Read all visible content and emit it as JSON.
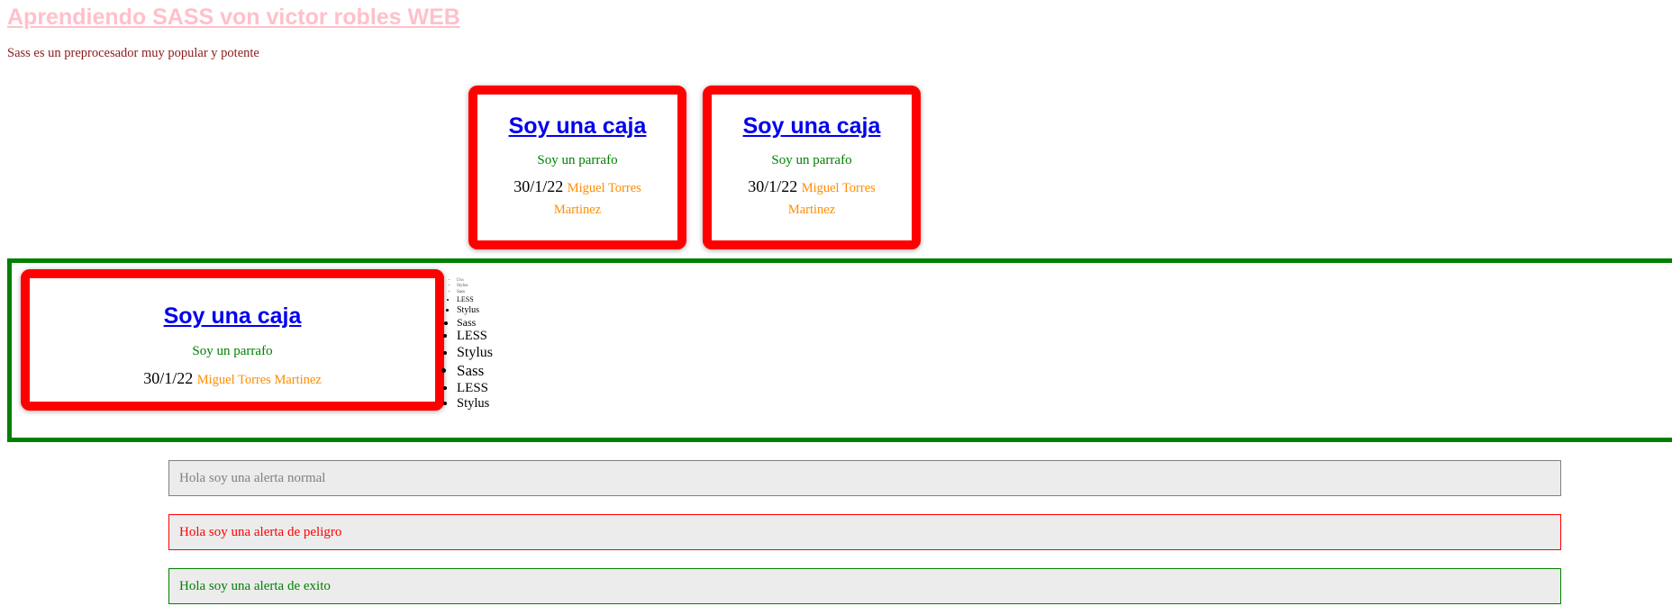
{
  "header": {
    "title": "Aprendiendo SASS von victor robles WEB",
    "intro": "Sass es un preprocesador muy popular y potente"
  },
  "cajas": [
    {
      "title": "Soy una caja",
      "text": "Soy un parrafo",
      "date": "30/1/22",
      "author": "Miguel Torres Martinez"
    },
    {
      "title": "Soy una caja",
      "text": "Soy un parrafo",
      "date": "30/1/22",
      "author": "Miguel Torres Martinez"
    },
    {
      "title": "Soy una caja",
      "text": "Soy un parrafo",
      "date": "30/1/22",
      "author": "Miguel Torres Martinez"
    }
  ],
  "lista": [
    "Dos",
    "Stylus",
    "Sass",
    "LESS",
    "Stylus",
    "Sass",
    "LESS",
    "Stylus",
    "Sass",
    "LESS",
    "Stylus"
  ],
  "alertas": {
    "normal": "Hola soy una alerta normal",
    "peligro": "Hola soy una alerta de peligro",
    "exito": "Hola soy una alerta de exito"
  },
  "colors": {
    "title": "#ffc0cb",
    "intro": "#8b1a1a",
    "caja_border": "#ff0000",
    "caja_link": "#0000ee",
    "parrafo": "#008000",
    "author": "#ff8c00",
    "contenedor_border": "#008000",
    "alerta_bg": "#ececec",
    "alerta_normal": "#808080",
    "alerta_peligro": "#ff0000",
    "alerta_exito": "#008000"
  }
}
